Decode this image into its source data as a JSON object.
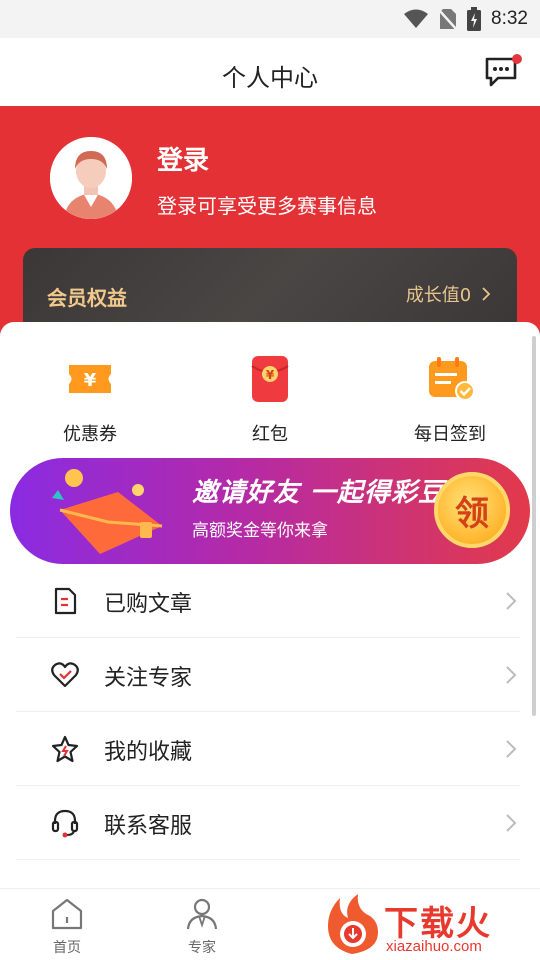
{
  "status_bar": {
    "time": "8:32"
  },
  "header": {
    "title": "个人中心"
  },
  "profile": {
    "login_label": "登录",
    "login_subtitle": "登录可享受更多赛事信息"
  },
  "member": {
    "label": "会员权益",
    "growth": "成长值0"
  },
  "quick_actions": [
    {
      "label": "优惠券",
      "icon": "coupon-icon"
    },
    {
      "label": "红包",
      "icon": "red-envelope-icon"
    },
    {
      "label": "每日签到",
      "icon": "calendar-checkin-icon"
    }
  ],
  "banner": {
    "title": "邀请好友 一起得彩豆",
    "subtitle": "高额奖金等你来拿",
    "button": "领"
  },
  "menu": [
    {
      "label": "已购文章",
      "icon": "document-icon"
    },
    {
      "label": "关注专家",
      "icon": "heart-check-icon"
    },
    {
      "label": "我的收藏",
      "icon": "star-icon"
    },
    {
      "label": "联系客服",
      "icon": "headset-icon"
    }
  ],
  "tabbar": [
    {
      "label": "首页",
      "icon": "home-icon"
    },
    {
      "label": "专家",
      "icon": "expert-icon"
    }
  ],
  "watermark": {
    "text": "下载火",
    "url": "xiazaihuo.com"
  },
  "colors": {
    "brand_red": "#e33135",
    "gold": "#f1c98c"
  }
}
